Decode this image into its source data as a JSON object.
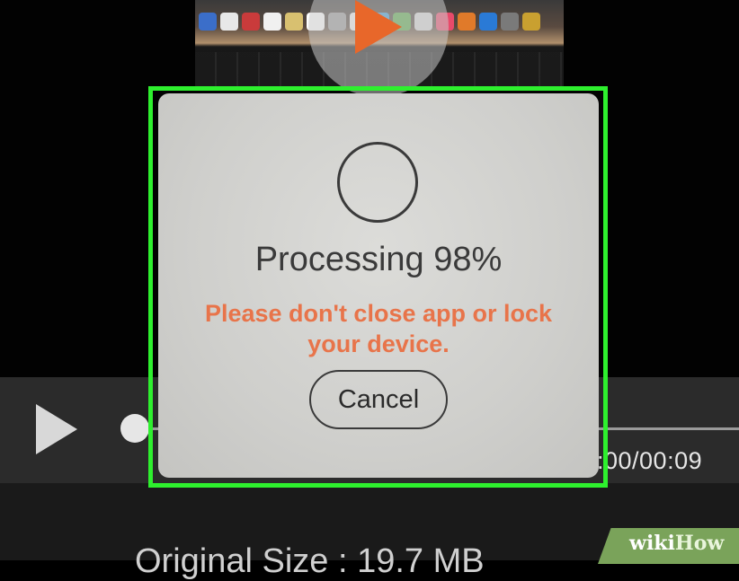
{
  "dialog": {
    "title": "Processing 98%",
    "progress_percent": 98,
    "warning": "Please don't close app or lock your device.",
    "cancel_label": "Cancel"
  },
  "player": {
    "time_display": ":00/00:09"
  },
  "file_info": {
    "size_label": "Original Size : 19.7 MB"
  },
  "watermark": {
    "part1": "wiki",
    "part2": "How"
  },
  "colors": {
    "accent_orange": "#e8744a",
    "highlight_green": "#2ef02e",
    "dialog_bg": "#d2d2cf",
    "player_bar": "#2b2b2b"
  },
  "icons": {
    "play_overlay": "play-icon",
    "player_play": "play-icon",
    "spinner": "loading-circle-icon"
  }
}
